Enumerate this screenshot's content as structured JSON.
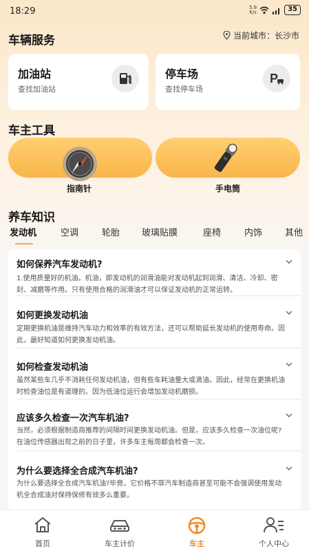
{
  "status": {
    "time": "18:29",
    "net_speed_top": "5.9",
    "net_speed_bottom": "K/s",
    "battery": "35"
  },
  "header": {
    "title": "车辆服务",
    "city_label": "当前城市：长沙市"
  },
  "services": [
    {
      "title": "加油站",
      "sub": "查找加油站",
      "icon": "fuel-pump-icon"
    },
    {
      "title": "停车场",
      "sub": "查找停车场",
      "icon": "parking-icon"
    }
  ],
  "tools": {
    "title": "车主工具",
    "items": [
      {
        "label": "指南针",
        "icon": "compass-icon"
      },
      {
        "label": "手电筒",
        "icon": "flashlight-icon"
      }
    ]
  },
  "knowledge": {
    "title": "养车知识",
    "tabs": [
      "发动机",
      "空调",
      "轮胎",
      "玻璃贴膜",
      "座椅",
      "内饰",
      "其他"
    ],
    "active_tab": "发动机",
    "articles": [
      {
        "title": "如何保养汽车发动机?",
        "desc": "1.使用质量好的机油。机油，即发动机的润滑油能对发动机起到润滑、清洁、冷却、密封、减磨等作用。只有使用合格的润滑油才可以保证发动机的正常运转。"
      },
      {
        "title": "如何更换发动机油",
        "desc": "定期更换机油是维持汽车动力和效率的有效方法，还可以帮助延长发动机的使用寿命。因此，最好知道如何更换发动机油。"
      },
      {
        "title": "如何检查发动机油",
        "desc": "虽然某些车几乎不消耗任何发动机油，但有些车耗油量大或滴油。因此，经常在更换机油时检查油位是有道理的。因为低油位运行会增加发动机磨损。"
      },
      {
        "title": "应该多久检查一次汽车机油?",
        "desc": "当然，必须根据制造商推荐的间隔时间更换发动机油。但是，应该多久检查一次油位呢?在油位传感器出现之前的日子里，许多车主每周都会检查一次。"
      },
      {
        "title": "为什么要选择全合成汽车机油?",
        "desc": "为什么要选择全合成汽车机油?毕竟，它价格不菲汽车制造商甚至可能不会强调使用发动机全合成油对保持保修有效多么重要。"
      }
    ]
  },
  "nav": [
    {
      "label": "首页",
      "icon": "home-icon"
    },
    {
      "label": "车主计价",
      "icon": "car-icon"
    },
    {
      "label": "车主",
      "icon": "steering-wheel-icon"
    },
    {
      "label": "个人中心",
      "icon": "profile-icon"
    }
  ],
  "colors": {
    "accent": "#f08c2e",
    "tool_card": "#fbbd52"
  }
}
